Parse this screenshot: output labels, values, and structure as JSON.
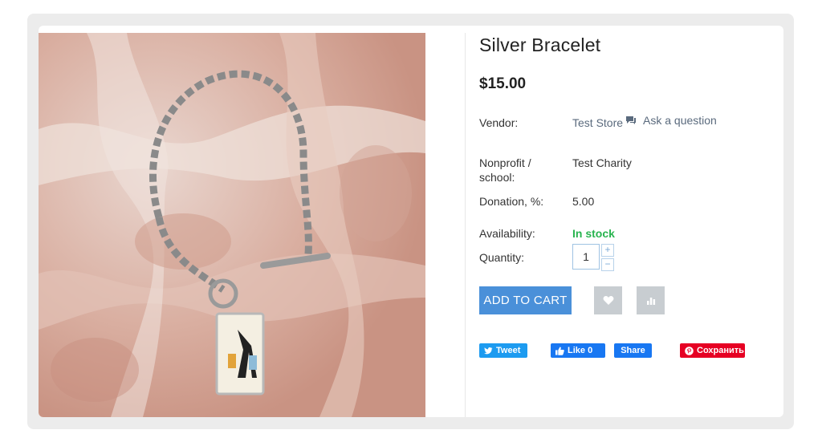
{
  "product": {
    "title": "Silver Bracelet",
    "price": "$15.00"
  },
  "details": {
    "vendor_label": "Vendor:",
    "vendor_value": "Test Store",
    "ask_question": "Ask a question",
    "nonprofit_label_line1": "Nonprofit /",
    "nonprofit_label_line2": "school:",
    "nonprofit_value": "Test Charity",
    "donation_label": "Donation, %:",
    "donation_value": "5.00",
    "availability_label": "Availability:",
    "availability_value": "In stock",
    "quantity_label": "Quantity:",
    "quantity_value": "1"
  },
  "actions": {
    "add_to_cart": "ADD TO CART",
    "plus": "+",
    "minus": "−"
  },
  "social": {
    "tweet": "Tweet",
    "like": "Like 0",
    "share": "Share",
    "pin": "Сохранить"
  },
  "colors": {
    "accent": "#4a90d9",
    "in_stock": "#28b44f",
    "twitter": "#1d9bf0",
    "facebook": "#1877f2",
    "pinterest": "#e60023"
  }
}
